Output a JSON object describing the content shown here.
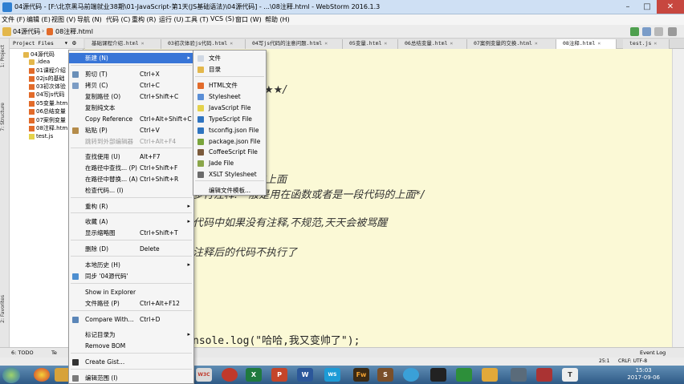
{
  "window": {
    "title": "04源代码 - [F:\\北京黑马前端就业38期\\01-JavaScript-第1天(JS基础语法)\\04源代码] - ...\\08注释.html - WebStorm 2016.1.3",
    "minimize": "–",
    "maximize": "□",
    "close": "✕"
  },
  "menubar": [
    "文件 (F)",
    "编辑 (E)",
    "视图 (V)",
    "导航 (N)",
    "代码 (C)",
    "重构 (R)",
    "运行 (U)",
    "工具 (T)",
    "VCS (S)",
    "窗口 (W)",
    "帮助 (H)"
  ],
  "breadcrumb": [
    "04源代码",
    "08注释.html"
  ],
  "project_panel": {
    "header": "Project Files",
    "items": [
      {
        "label": "04源代码",
        "type": "folder"
      },
      {
        "label": ".idea",
        "type": "folder"
      },
      {
        "label": "01课程介绍",
        "type": "html"
      },
      {
        "label": "02js的基础",
        "type": "html"
      },
      {
        "label": "03初次体验",
        "type": "html"
      },
      {
        "label": "04写js代码",
        "type": "html"
      },
      {
        "label": "05变量.htm",
        "type": "html"
      },
      {
        "label": "06总结变量",
        "type": "html"
      },
      {
        "label": "07案例变量",
        "type": "html"
      },
      {
        "label": "08注释.htm",
        "type": "html"
      },
      {
        "label": "test.js",
        "type": "js"
      }
    ]
  },
  "left_strip": [
    "1: Project",
    "7: Structure",
    "2: Favorites"
  ],
  "tabs": [
    {
      "label": "基础课程介绍.html",
      "active": false
    },
    {
      "label": "03初次体验js代码.html",
      "active": false
    },
    {
      "label": "04写js代码的注意问题.html",
      "active": false
    },
    {
      "label": "05变量.html",
      "active": false
    },
    {
      "label": "06总结变量.html",
      "active": false
    },
    {
      "label": "07案例变量的交换.html",
      "active": false
    },
    {
      "label": "08注释.html",
      "active": true
    },
    {
      "label": "test.js",
      "active": false
    }
  ],
  "editor": {
    "lines": [
      "/",
      "★★/",
      "用在一行代码的上面",
      "多行注释:一般是用在函数或者是一段代码的上面*/",
      "代码中如果没有注释,不规范,天天会被骂醒",
      "注释后的代码不执行了",
      "nsole.log(\"哈哈,我又变帅了\");"
    ]
  },
  "context_menu": {
    "items": [
      {
        "label": "新建 (N)",
        "shortcut": "",
        "submenu": true,
        "highlighted": true,
        "icon": ""
      },
      {
        "label": "剪切 (T)",
        "shortcut": "Ctrl+X",
        "icon": "scissors-icon"
      },
      {
        "label": "拷贝 (C)",
        "shortcut": "Ctrl+C",
        "icon": "copy-icon"
      },
      {
        "label": "复制路径 (O)",
        "shortcut": "Ctrl+Shift+C"
      },
      {
        "label": "复制纯文本",
        "shortcut": ""
      },
      {
        "label": "Copy Reference",
        "shortcut": "Ctrl+Alt+Shift+C"
      },
      {
        "label": "粘贴 (P)",
        "shortcut": "Ctrl+V",
        "icon": "paste-icon"
      },
      {
        "label": "跳转到外部编辑器",
        "shortcut": "Ctrl+Alt+F4",
        "disabled": true
      },
      {
        "label": "查找使用 (U)",
        "shortcut": "Alt+F7"
      },
      {
        "label": "在路径中查找... (P)",
        "shortcut": "Ctrl+Shift+F"
      },
      {
        "label": "在路径中替换... (A)",
        "shortcut": "Ctrl+Shift+R"
      },
      {
        "label": "检查代码... (I)",
        "shortcut": ""
      },
      {
        "label": "重构 (R)",
        "shortcut": "",
        "submenu": true
      },
      {
        "label": "收藏 (A)",
        "shortcut": "",
        "submenu": true
      },
      {
        "label": "显示缩略图",
        "shortcut": "Ctrl+Shift+T"
      },
      {
        "label": "删除 (D)",
        "shortcut": "Delete"
      },
      {
        "label": "本地历史 (H)",
        "shortcut": "",
        "submenu": true
      },
      {
        "label": "同步 '04源代码'",
        "shortcut": "",
        "icon": "sync-icon"
      },
      {
        "label": "Show in Explorer",
        "shortcut": ""
      },
      {
        "label": "文件路径 (P)",
        "shortcut": "Ctrl+Alt+F12"
      },
      {
        "label": "Compare With...",
        "shortcut": "Ctrl+D",
        "icon": "compare-icon"
      },
      {
        "label": "标记目录为",
        "shortcut": "",
        "submenu": true
      },
      {
        "label": "Remove BOM",
        "shortcut": ""
      },
      {
        "label": "Create Gist...",
        "shortcut": "",
        "icon": "gist-icon"
      },
      {
        "label": "编辑范围 (I)",
        "shortcut": "",
        "icon": "scope-icon"
      }
    ]
  },
  "submenu_new": {
    "items": [
      {
        "label": "文件",
        "color": "#d0d8e4"
      },
      {
        "label": "目录",
        "color": "#e3b74b"
      },
      {
        "label": "HTML文件",
        "color": "#e26b2a"
      },
      {
        "label": "Stylesheet",
        "color": "#5a8ed6"
      },
      {
        "label": "JavaScript File",
        "color": "#e4d24b"
      },
      {
        "label": "TypeScript File",
        "color": "#2f74c0"
      },
      {
        "label": "tsconfig.json File",
        "color": "#2f74c0"
      },
      {
        "label": "package.json File",
        "color": "#7aa53c"
      },
      {
        "label": "CoffeeScript File",
        "color": "#7b5a3b"
      },
      {
        "label": "Jade File",
        "color": "#8aa64a"
      },
      {
        "label": "XSLT Stylesheet",
        "color": "#6b6b6b"
      },
      {
        "label": "编辑文件模板...",
        "color": ""
      }
    ]
  },
  "bottom": {
    "todo": "6: TODO",
    "terminal": "Te",
    "event_log": "Event Log",
    "position": "25:1",
    "encoding": "CRLF: UTF-8"
  },
  "taskbar": {
    "time": "15:03",
    "date": "2017-09-06"
  },
  "colors": {
    "editor_bg": "#fbf9d6",
    "menu_highlight": "#3875d7",
    "title_bg": "#cfe0f4"
  }
}
